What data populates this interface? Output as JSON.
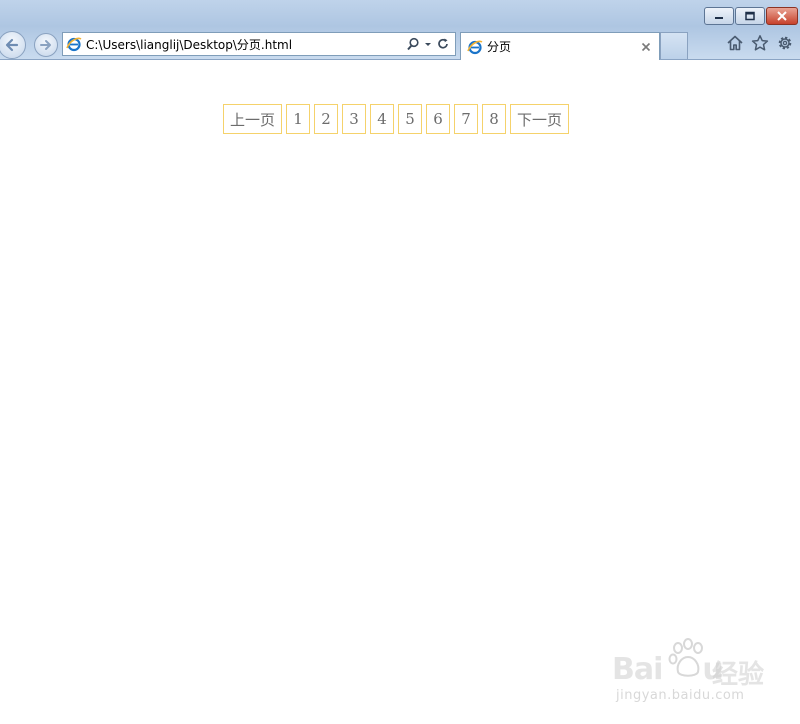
{
  "browser": {
    "address_url": "C:\\Users\\lianglij\\Desktop\\分页.html",
    "tab_title": "分页",
    "icons": [
      "back-icon",
      "forward-icon",
      "ie-favicon",
      "search-icon",
      "dropdown-icon",
      "refresh-icon",
      "tab-close-icon",
      "home-icon",
      "favorites-star-icon",
      "settings-gear-icon",
      "minimize-icon",
      "maximize-icon",
      "window-close-icon"
    ]
  },
  "pagination": {
    "prev_label": "上一页",
    "pages": [
      "1",
      "2",
      "3",
      "4",
      "5",
      "6",
      "7",
      "8"
    ],
    "next_label": "下一页",
    "border_color": "#f5d26b"
  },
  "watermark": {
    "brand_latin": "Bai",
    "brand_latin_tail": "u",
    "brand_cn": "经验",
    "site": "jingyan.baidu.com"
  }
}
